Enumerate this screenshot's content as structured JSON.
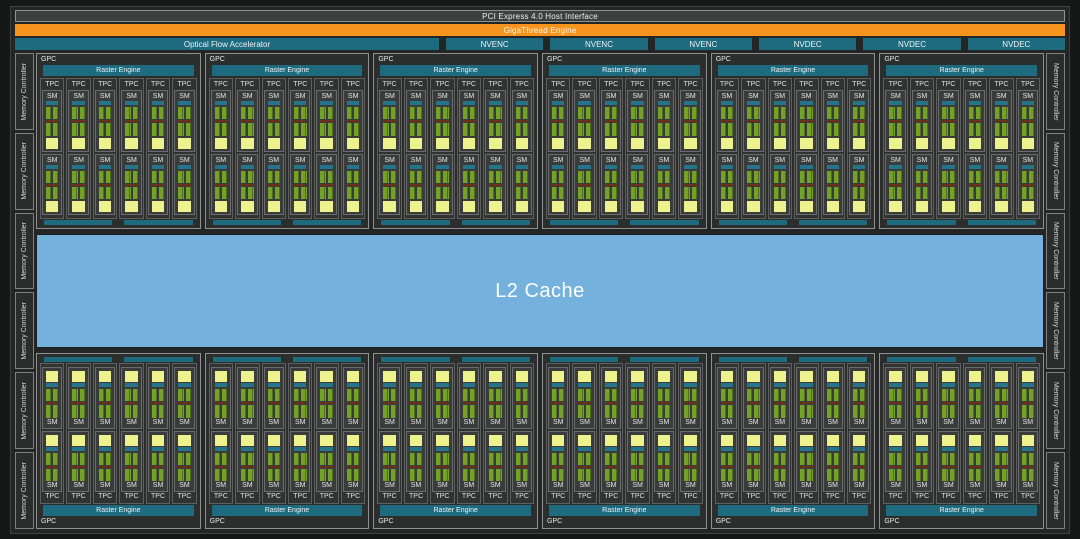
{
  "header": {
    "pci_label": "PCI Express 4.0 Host Interface",
    "gigathread_label": "GigaThread Engine",
    "optical_flow_label": "Optical Flow Accelerator",
    "media_units": [
      "NVENC",
      "NVENC",
      "NVENC",
      "NVDEC",
      "NVDEC",
      "NVDEC"
    ]
  },
  "l2_cache": {
    "label": "L2 Cache"
  },
  "memory_controllers": {
    "label": "Memory Controller",
    "left_count": 6,
    "right_count": 6
  },
  "gpc_blocks": {
    "top_row_count": 6,
    "bottom_row_count": 6,
    "tpc_per_gpc": 6,
    "sm_per_tpc": 2,
    "green_rows_per_sm": 2,
    "gpc_label": "GPC",
    "raster_engine_label": "Raster Engine",
    "tpc_label": "TPC",
    "sm_label": "SM"
  },
  "colors": {
    "background": "#242525",
    "teal": "#1e6b80",
    "orange": "#f7941e",
    "pci_gray": "#3e4040",
    "l2_blue": "#74b1dd",
    "core_green": "#74a228",
    "cache_yellow": "#edf28d",
    "tensor_red": "#6b2f1a"
  }
}
